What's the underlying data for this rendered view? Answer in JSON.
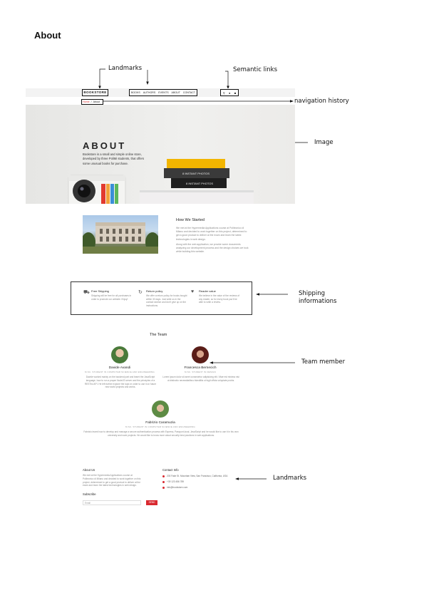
{
  "page_title": "About",
  "annotations": {
    "landmarks_top": "Landmarks",
    "semantic_links": "Semantic links",
    "navigation_history": "navigation history",
    "image": "Image",
    "shipping_line1": "Shipping",
    "shipping_line2": "informations",
    "team_member": "Team member",
    "landmarks_bottom": "Landmarks"
  },
  "site": {
    "logo": "BOOKSTORE",
    "nav": [
      "BOOKS",
      "AUTHORS",
      "EVENTS",
      "ABOUT",
      "CONTACT"
    ],
    "breadcrumb": {
      "home": "Home",
      "current": "About"
    },
    "hero": {
      "title": "ABOUT",
      "text": "Bookstore is a small and simple online store, developed by three PoliMi students, that offers some unusual books for purchase.",
      "books": [
        "8 INSTANT PHOTOS",
        "8 INSTANT PHOTOS",
        "8 INSTANT PHOTOS"
      ]
    },
    "started": {
      "title": "How We Started",
      "p1": "We met at the Hypermedia Applications course at Politecnico di Milano and decided to work together on this project, determined to get a good product to deliver at the exam and learn the latest technologies in web design.",
      "p2": "Along with the web application, we provide some documents analyzing our development process and the design choices we took while building this website."
    },
    "shipping": [
      {
        "icon": "truck-icon",
        "title": "Free Shipping",
        "desc": "Shipping will be free for all purchases in order to promote our website. Enjoy!"
      },
      {
        "icon": "refresh-icon",
        "title": "Return policy",
        "desc": "We offer a return policy for books bought within 30 days. Just write us in the contact section and don't give up on the instructions."
      },
      {
        "icon": "heart-icon",
        "title": "Reader value",
        "desc": "We believe in the value of the reviews of any reader, so for every book you'll be able to write a review."
      }
    ],
    "team": {
      "title": "The Team",
      "members": [
        {
          "name": "Davide Avandi",
          "role": "M.SC. STUDENT IN COMPUTER SCIENCE AND ENGINEERING",
          "desc": "Davide worked mainly on the backend part and learnt the JavaScript language, how to run a proper NodeJS server and the principles of a RESTful API. He left further explore the topic in order to use it on future new world projects and works."
        },
        {
          "name": "Francesca Bernecich",
          "role": "M.SC. STUDENT IN DESIGN",
          "desc": "Lorem ipsum dolor sit amet consectetur adipisicing elit. Vitae est minima nisi ut distinctio necessitatibus blanditiis ut fugit officia voluptate probis."
        },
        {
          "name": "Fabrizio Caramuzia",
          "role": "M.SC. STUDENT IN COMPUTER SCIENCE AND ENGINEERING",
          "desc": "Fabrizio learnt how to develop and manage a secure authentication process with Express, Passport-local, JavaScript and he would like to use it in his own university and work projects. He would like to know more about security best practices in web applications."
        }
      ]
    },
    "footer": {
      "about_title": "About Us",
      "about_text": "We met at the Hypermedia Applications course at Politecnico di Milano and decided to work together on this project, determined to get a good product to deliver at the exam and learn the latest technologies in web design.",
      "subscribe": "Subscribe",
      "email_placeholder": "Email",
      "subscribe_btn": "SEND",
      "contact_title": "Contact Info",
      "address": "203 Fake St. Mountain View, San Francisco, California, USA",
      "phone": "+39 123 456 789",
      "email": "info@bookstore.com"
    }
  },
  "colors": {
    "accent": "#d9282f",
    "border": "#333333"
  }
}
